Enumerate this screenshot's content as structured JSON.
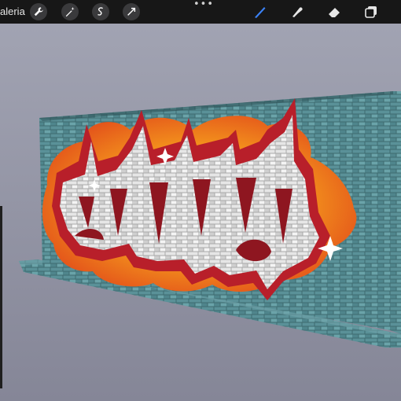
{
  "toolbar": {
    "gallery_label": "aleria",
    "more_label": "•••"
  },
  "icons": {
    "wrench": "wrench-icon",
    "magic": "magic-wand-icon",
    "selection": "selection-icon",
    "transform": "transform-arrow-icon",
    "brush": "brush-icon",
    "smudge": "smudge-icon",
    "eraser": "eraser-icon",
    "layers": "layers-icon"
  },
  "colors": {
    "toolbar_bg": "#171717",
    "canvas_bg": "#8e8f9f",
    "active_tool": "#3b82f6",
    "icon": "#ffffff"
  }
}
